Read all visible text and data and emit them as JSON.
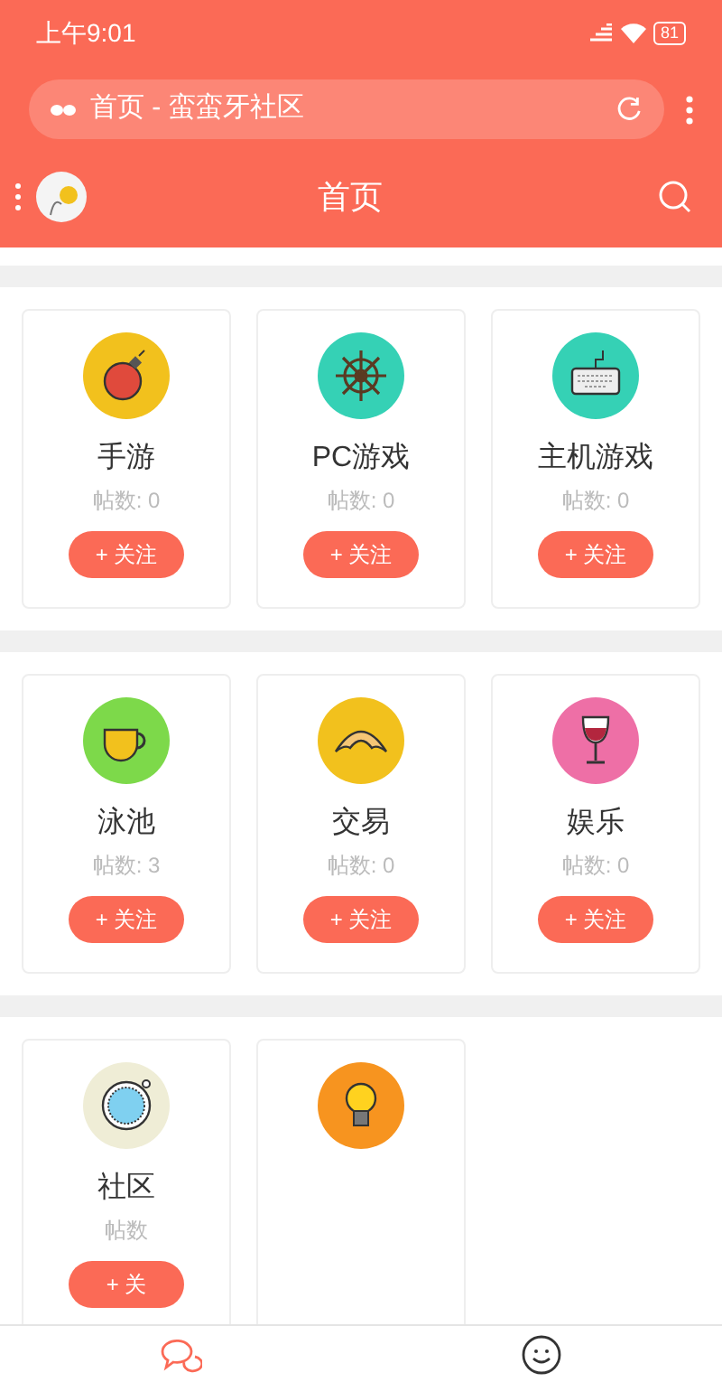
{
  "status_bar": {
    "time": "上午9:01",
    "battery": "81"
  },
  "address_bar": {
    "title": "首页 - 蛮蛮牙社区"
  },
  "header": {
    "title": "首页"
  },
  "sections": [
    {
      "boards": [
        {
          "name": "手游",
          "posts": "帖数: 0",
          "follow": "+ 关注"
        },
        {
          "name": "PC游戏",
          "posts": "帖数: 0",
          "follow": "+ 关注"
        },
        {
          "name": "主机游戏",
          "posts": "帖数: 0",
          "follow": "+ 关注"
        }
      ]
    },
    {
      "boards": [
        {
          "name": "泳池",
          "posts": "帖数: 3",
          "follow": "+ 关注"
        },
        {
          "name": "交易",
          "posts": "帖数: 0",
          "follow": "+ 关注"
        },
        {
          "name": "娱乐",
          "posts": "帖数: 0",
          "follow": "+ 关注"
        }
      ]
    },
    {
      "boards": [
        {
          "name": "社区",
          "posts": "帖数",
          "follow": "+ 关"
        },
        {
          "kind": "icon_only"
        }
      ]
    }
  ],
  "bottom_nav": [
    {
      "selected": true
    },
    {
      "selected": false
    }
  ]
}
